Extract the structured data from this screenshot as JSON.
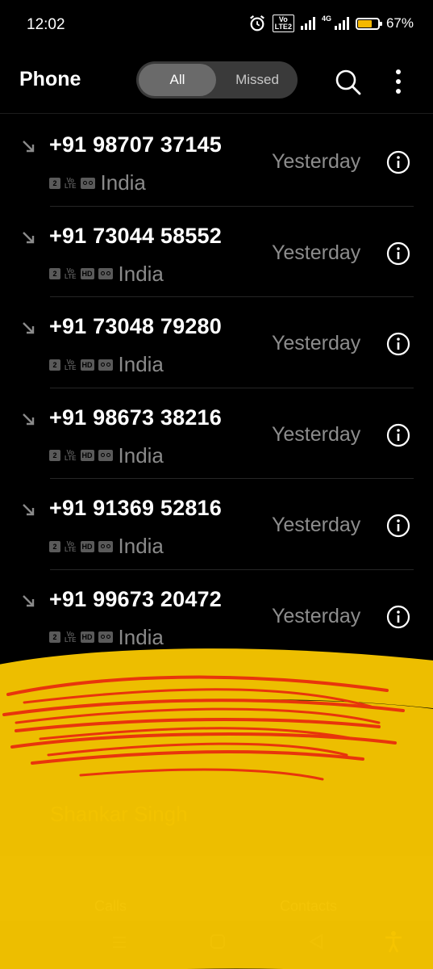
{
  "status_bar": {
    "time": "12:02",
    "volte_label_top": "Vo",
    "volte_label_bottom": "LTE2",
    "network_label": "4G",
    "battery_percent": "67%",
    "battery_level": 0.67
  },
  "app_bar": {
    "title": "Phone",
    "tabs": [
      {
        "label": "All",
        "selected": true
      },
      {
        "label": "Missed",
        "selected": false
      }
    ]
  },
  "calls": [
    {
      "number": "+91 98707 37145",
      "sim": "2",
      "volte": [
        "Vo",
        "LTE"
      ],
      "hd": "",
      "location": "India",
      "when": "Yesterday"
    },
    {
      "number": "+91 73044 58552",
      "sim": "2",
      "volte": [
        "Vo",
        "LTE"
      ],
      "hd": "HD",
      "location": "India",
      "when": "Yesterday"
    },
    {
      "number": "+91 73048 79280",
      "sim": "2",
      "volte": [
        "Vo",
        "LTE"
      ],
      "hd": "HD",
      "location": "India",
      "when": "Yesterday"
    },
    {
      "number": "+91 98673 38216",
      "sim": "2",
      "volte": [
        "Vo",
        "LTE"
      ],
      "hd": "HD",
      "location": "India",
      "when": "Yesterday"
    },
    {
      "number": "+91 91369 52816",
      "sim": "2",
      "volte": [
        "Vo",
        "LTE"
      ],
      "hd": "HD",
      "location": "India",
      "when": "Yesterday"
    },
    {
      "number": "+91 99673 20472",
      "sim": "2",
      "volte": [
        "Vo",
        "LTE"
      ],
      "hd": "HD",
      "location": "India",
      "when": "Yesterday"
    }
  ],
  "partial_contact": "Shankar Singh",
  "bottom_nav": {
    "calls_label": "Calls",
    "contacts_label": "Contacts"
  },
  "colors": {
    "scribble_yellow": "#f7c600",
    "scribble_red": "#e8350c",
    "accent_battery": "#f5b800"
  }
}
